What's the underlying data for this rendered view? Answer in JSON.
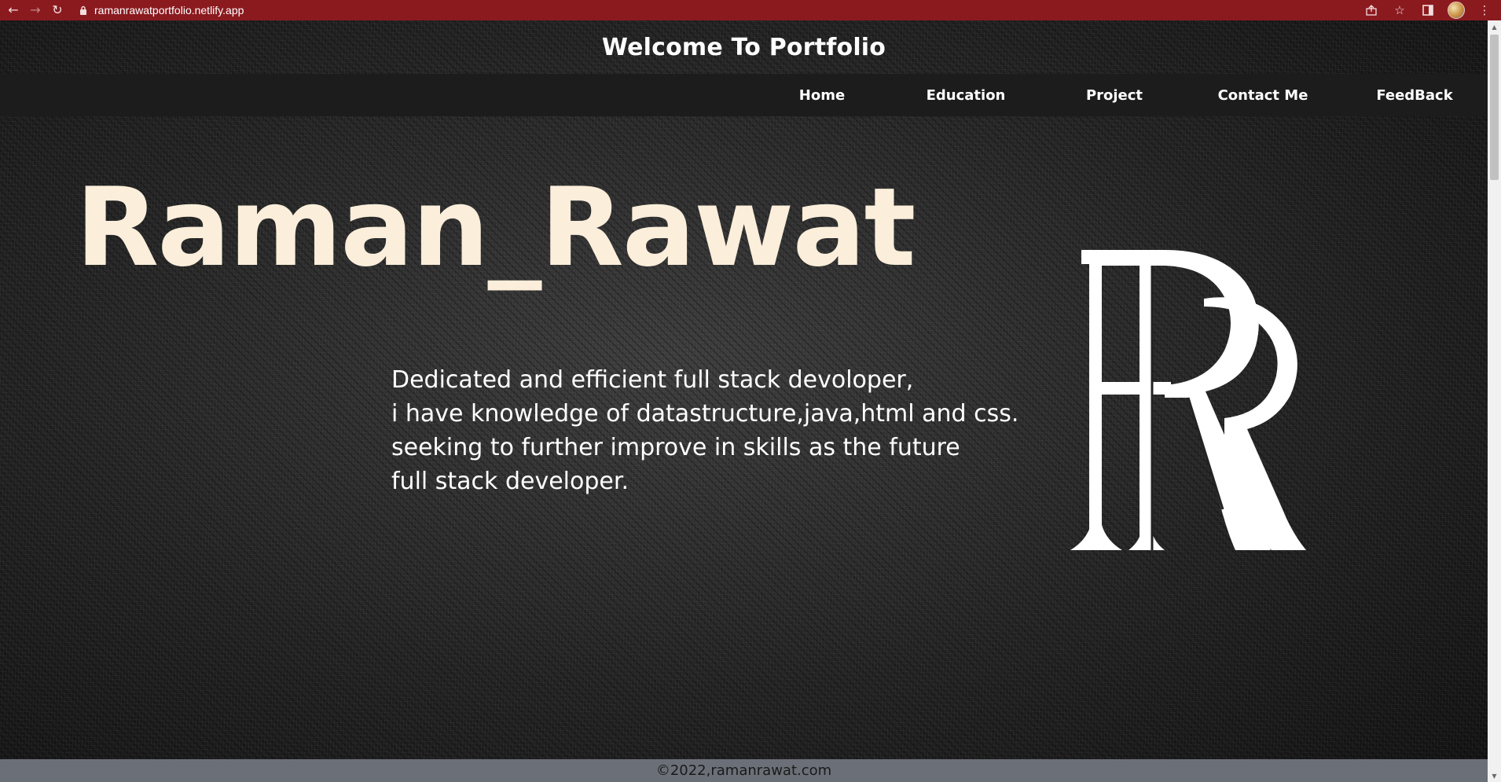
{
  "browser": {
    "back_icon": "back-arrow-icon",
    "forward_icon": "forward-arrow-icon",
    "reload_icon": "reload-icon",
    "url": "ramanrawatportfolio.netlify.app",
    "colors": {
      "tab_bar": "#8b1a1f"
    }
  },
  "site": {
    "title": "Welcome To Portfolio"
  },
  "nav": {
    "items": [
      {
        "label": "Home"
      },
      {
        "label": "Education"
      },
      {
        "label": "Project"
      },
      {
        "label": "Contact Me"
      },
      {
        "label": "FeedBack"
      }
    ]
  },
  "hero": {
    "name": "Raman_Rawat",
    "description_lines": [
      "Dedicated and efficient full stack devoloper,",
      "i have knowledge of datastructure,java,html and css.",
      "seeking to further improve in skills as the future",
      "full stack developer."
    ],
    "logo_icon": "rr-monogram-logo",
    "colors": {
      "name": "#fbeedb",
      "text": "#ffffff",
      "background": "#232323"
    }
  },
  "footer": {
    "text": "©2022,ramanrawat.com"
  }
}
